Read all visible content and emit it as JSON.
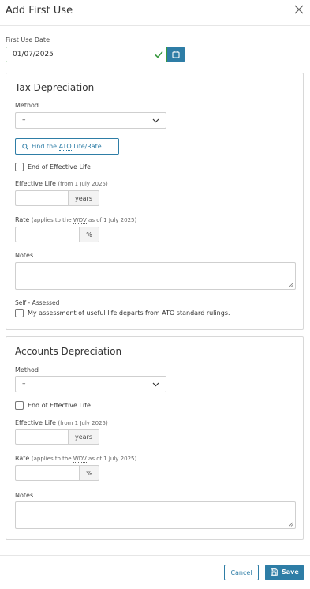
{
  "dialog": {
    "title": "Add First Use"
  },
  "first_use": {
    "label": "First Use Date",
    "value": "01/07/2025"
  },
  "tax": {
    "title": "Tax Depreciation",
    "method_label": "Method",
    "method_value": "–",
    "find_button_prefix": "Find the ",
    "find_button_abbr": "ATO",
    "find_button_suffix": " Life/Rate",
    "end_of_life_label": "End of Effective Life",
    "effective_life_label": "Effective Life",
    "effective_life_note": "(from 1 July 2025)",
    "effective_life_unit": "years",
    "rate_label": "Rate",
    "rate_note_prefix": "(applies to the ",
    "rate_note_abbr": "WDV",
    "rate_note_suffix": " as of 1 July 2025)",
    "rate_unit": "%",
    "notes_label": "Notes",
    "self_assessed_label": "Self - Assessed",
    "self_assessed_check": "My assessment of useful life departs from ATO standard rulings."
  },
  "accounts": {
    "title": "Accounts Depreciation",
    "method_label": "Method",
    "method_value": "–",
    "end_of_life_label": "End of Effective Life",
    "effective_life_label": "Effective Life",
    "effective_life_note": "(from 1 July 2025)",
    "effective_life_unit": "years",
    "rate_label": "Rate",
    "rate_note_prefix": "(applies to the ",
    "rate_note_abbr": "WDV",
    "rate_note_suffix": " as of 1 July 2025)",
    "rate_unit": "%",
    "notes_label": "Notes"
  },
  "footer": {
    "cancel_label": "Cancel",
    "save_label": "Save"
  },
  "colors": {
    "primary": "#2e7da6",
    "valid": "#3a9a40"
  }
}
